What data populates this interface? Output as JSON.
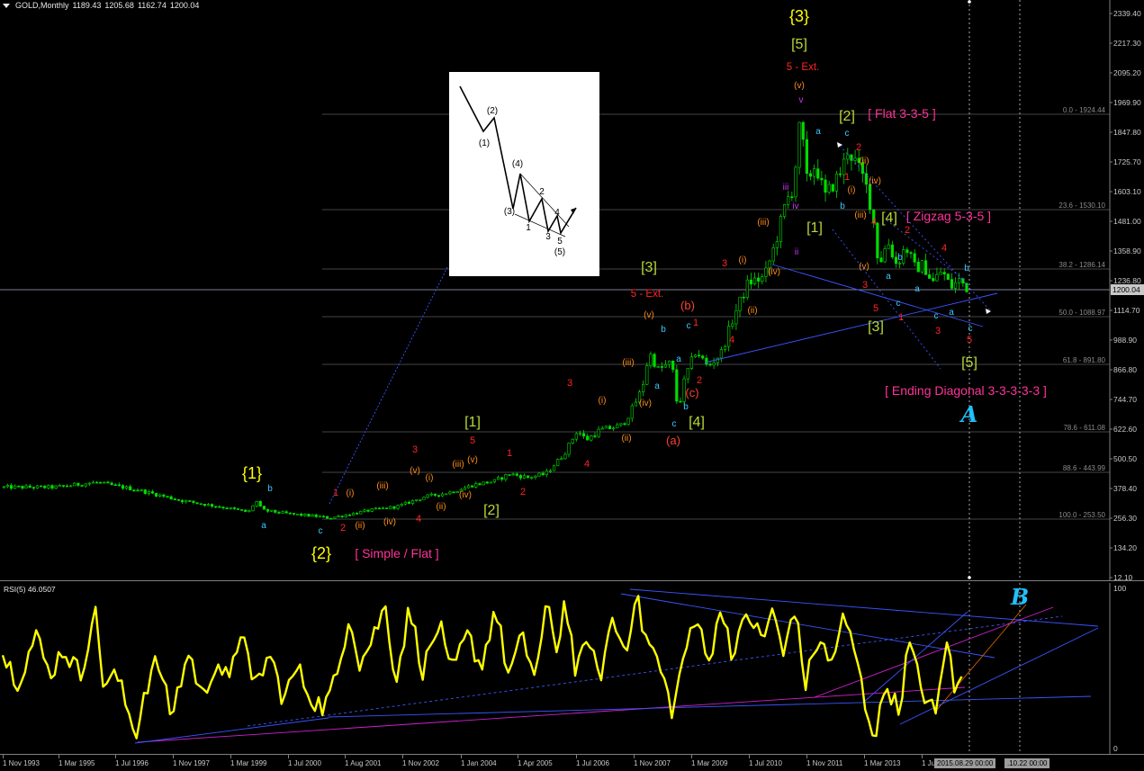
{
  "header": {
    "symbol": "GOLD,Monthly",
    "open": "1189.43",
    "high": "1205.68",
    "low": "1162.74",
    "close": "1200.04"
  },
  "price_axis": {
    "labels": [
      "2339.40",
      "2217.30",
      "2095.20",
      "1969.90",
      "1847.80",
      "1725.70",
      "1603.10",
      "1481.00",
      "1358.90",
      "1236.80",
      "1114.70",
      "988.90",
      "866.80",
      "744.70",
      "622.60",
      "500.50",
      "378.40",
      "256.30",
      "134.20",
      "12.10"
    ],
    "current": "1200.04"
  },
  "fib_levels": [
    "0.0 - 1924.44",
    "23.6 - 1530.10",
    "38.2 - 1286.14",
    "50.0 - 1088.97",
    "61.8 - 891.80",
    "78.6 - 611.08",
    "88.6 - 443.99",
    "100.0 - 253.50"
  ],
  "wave_labels": [
    {
      "t": "{1}",
      "c": "deg"
    },
    {
      "t": "b",
      "c": "abc"
    },
    {
      "t": "a",
      "c": "abc"
    },
    {
      "t": "c",
      "c": "abc"
    },
    {
      "t": "{2}",
      "c": "deg"
    },
    {
      "t": "[ Simple / Flat ]",
      "c": "pat"
    },
    {
      "t": "1",
      "c": "num"
    },
    {
      "t": "(i)",
      "c": "rom"
    },
    {
      "t": "2",
      "c": "num"
    },
    {
      "t": "(ii)",
      "c": "rom"
    },
    {
      "t": "(iii)",
      "c": "rom"
    },
    {
      "t": "(iv)",
      "c": "rom"
    },
    {
      "t": "4",
      "c": "num"
    },
    {
      "t": "(v)",
      "c": "rom"
    },
    {
      "t": "3",
      "c": "num"
    },
    {
      "t": "(i)",
      "c": "rom"
    },
    {
      "t": "(ii)",
      "c": "rom"
    },
    {
      "t": "(iii)",
      "c": "rom"
    },
    {
      "t": "(iv)",
      "c": "rom"
    },
    {
      "t": "(v)",
      "c": "rom"
    },
    {
      "t": "5",
      "c": "num"
    },
    {
      "t": "[1]",
      "c": "sq"
    },
    {
      "t": "[2]",
      "c": "sq"
    },
    {
      "t": "1",
      "c": "num"
    },
    {
      "t": "2",
      "c": "num"
    },
    {
      "t": "3",
      "c": "num"
    },
    {
      "t": "4",
      "c": "num"
    },
    {
      "t": "(i)",
      "c": "rom"
    },
    {
      "t": "(ii)",
      "c": "rom"
    },
    {
      "t": "(iii)",
      "c": "rom"
    },
    {
      "t": "(iv)",
      "c": "rom"
    },
    {
      "t": "(v)",
      "c": "rom"
    },
    {
      "t": "5 - Ext.",
      "c": "ext"
    },
    {
      "t": "[3]",
      "c": "sq"
    },
    {
      "t": "b",
      "c": "abc"
    },
    {
      "t": "a",
      "c": "abc"
    },
    {
      "t": "c",
      "c": "abc"
    },
    {
      "t": "1",
      "c": "num"
    },
    {
      "t": "(b)",
      "c": "redp"
    },
    {
      "t": "(c)",
      "c": "redp"
    },
    {
      "t": "2",
      "c": "num"
    },
    {
      "t": "a",
      "c": "abc"
    },
    {
      "t": "b",
      "c": "abc"
    },
    {
      "t": "c",
      "c": "abc"
    },
    {
      "t": "[4]",
      "c": "sq"
    },
    {
      "t": "(a)",
      "c": "redp"
    },
    {
      "t": "3",
      "c": "num"
    },
    {
      "t": "4",
      "c": "num"
    },
    {
      "t": "(i)",
      "c": "rom"
    },
    {
      "t": "(ii)",
      "c": "rom"
    },
    {
      "t": "(iii)",
      "c": "rom"
    },
    {
      "t": "(iv)",
      "c": "rom"
    },
    {
      "t": "iii",
      "c": "vio"
    },
    {
      "t": "ii",
      "c": "vio"
    },
    {
      "t": "iv",
      "c": "vio"
    },
    {
      "t": "v",
      "c": "vio"
    },
    {
      "t": "(v)",
      "c": "rom"
    },
    {
      "t": "5 - Ext.",
      "c": "ext"
    },
    {
      "t": "[5]",
      "c": "sq"
    },
    {
      "t": "{3}",
      "c": "deg"
    },
    {
      "t": "a",
      "c": "abc"
    },
    {
      "t": "b",
      "c": "abc"
    },
    {
      "t": "[1]",
      "c": "sq"
    },
    {
      "t": "[2]",
      "c": "sq"
    },
    {
      "t": "[ Flat 3-3-5 ]",
      "c": "pat"
    },
    {
      "t": "c",
      "c": "abc"
    },
    {
      "t": "2",
      "c": "num"
    },
    {
      "t": "(ii)",
      "c": "rom"
    },
    {
      "t": "1",
      "c": "num"
    },
    {
      "t": "(i)",
      "c": "rom"
    },
    {
      "t": "(iv)",
      "c": "rom"
    },
    {
      "t": "(iii)",
      "c": "rom"
    },
    {
      "t": "4",
      "c": "num"
    },
    {
      "t": "(v)",
      "c": "rom"
    },
    {
      "t": "[4]",
      "c": "sq"
    },
    {
      "t": "[ Zigzag 5-3-5 ]",
      "c": "pat"
    },
    {
      "t": "3",
      "c": "num"
    },
    {
      "t": "5",
      "c": "num"
    },
    {
      "t": "c",
      "c": "abc"
    },
    {
      "t": "[3]",
      "c": "sq"
    },
    {
      "t": "1",
      "c": "num"
    },
    {
      "t": "2",
      "c": "num"
    },
    {
      "t": "4",
      "c": "num"
    },
    {
      "t": "3",
      "c": "num"
    },
    {
      "t": "5",
      "c": "num"
    },
    {
      "t": "a",
      "c": "abc"
    },
    {
      "t": "b",
      "c": "abc"
    },
    {
      "t": "a",
      "c": "abc"
    },
    {
      "t": "c",
      "c": "abc"
    },
    {
      "t": "a",
      "c": "abc"
    },
    {
      "t": "b",
      "c": "abc"
    },
    {
      "t": "c",
      "c": "abc"
    },
    {
      "t": "[5]",
      "c": "sq"
    },
    {
      "t": "[ Ending Diagonal 3-3-3-3-3 ]",
      "c": "pat"
    },
    {
      "t": "A",
      "c": "big"
    }
  ],
  "inset": {
    "labels": [
      "(1)",
      "(2)",
      "(3)",
      "(4)",
      "(5)",
      "1",
      "2",
      "3",
      "4",
      "5"
    ]
  },
  "rsi": {
    "title": "RSI(5) 46.0507",
    "scale_top": "100",
    "scale_bottom": "0",
    "marker": "B"
  },
  "time_axis": {
    "labels": [
      "1 Nov 1993",
      "1 Mar 1995",
      "1 Jul 1996",
      "1 Nov 1997",
      "1 Mar 1999",
      "1 Jul 2000",
      "1 Aug 2001",
      "1 Nov 2002",
      "1 Jan 2004",
      "1 Apr 2005",
      "1 Jul 2006",
      "1 Nov 2007",
      "1 Mar 2009",
      "1 Jul 2010",
      "1 Nov 2011",
      "1 Mar 2013",
      "1 Ju"
    ],
    "crosshair_date": "2015.08.29 00:00",
    "crosshair_date_2": ".10.22 00:00"
  },
  "colors": {
    "background": "#000000",
    "candles": "#00dc00",
    "rsi_line": "#ffff00",
    "trendline_blue": "#3a55ff",
    "trendline_magenta": "#d020d0",
    "trendline_orange": "#d06000"
  }
}
